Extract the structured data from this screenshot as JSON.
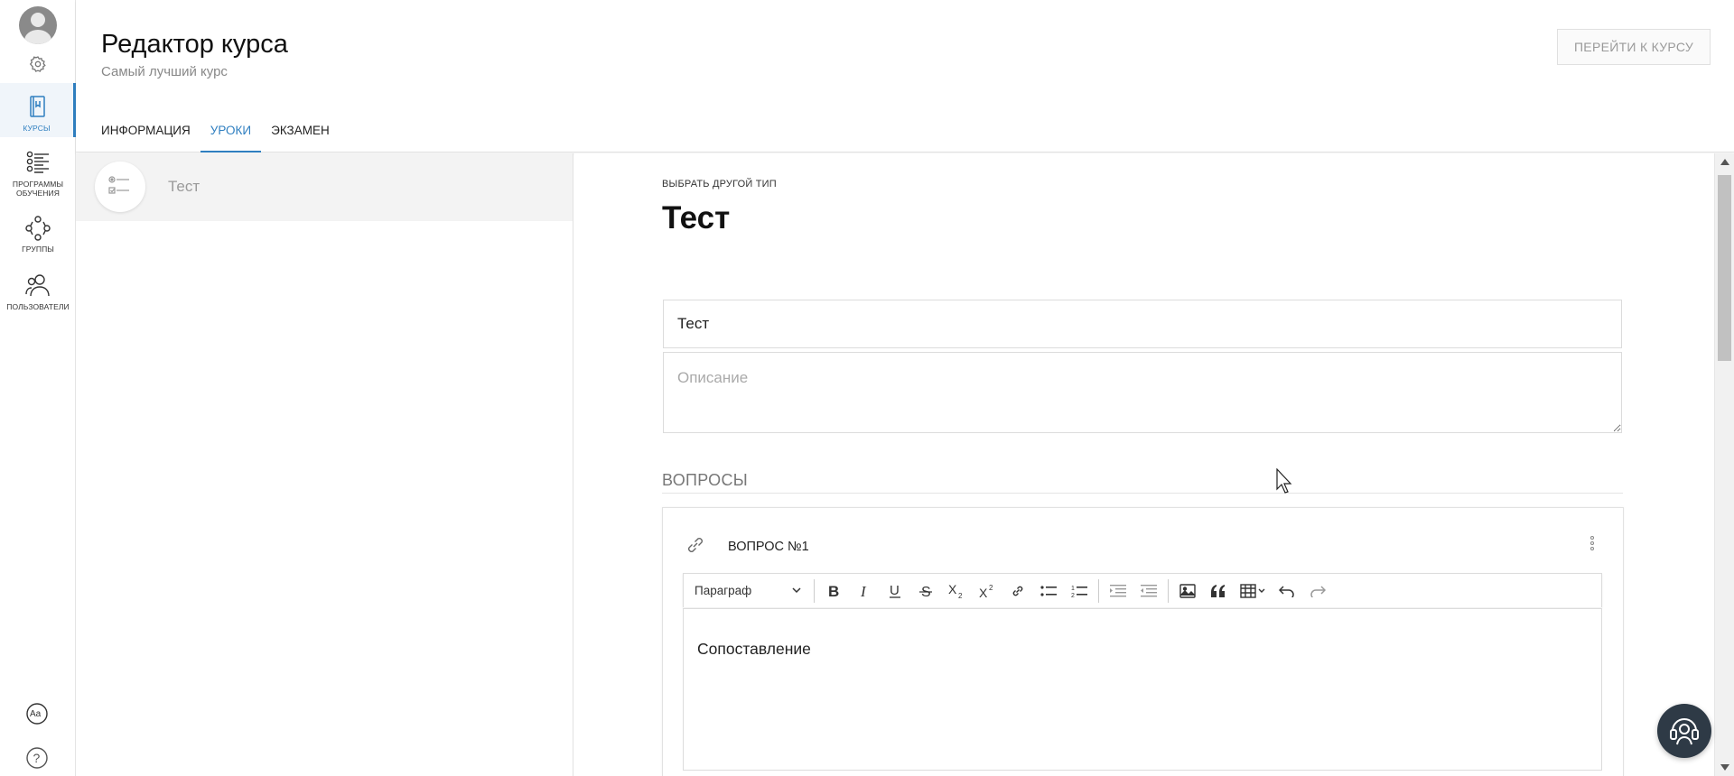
{
  "sidebar": {
    "items": [
      {
        "label": "КУРСЫ",
        "icon": "book-icon",
        "active": true
      },
      {
        "label": "ПРОГРАММЫ ОБУЧЕНИЯ",
        "icon": "checklist-icon",
        "active": false
      },
      {
        "label": "ГРУППЫ",
        "icon": "group-icon",
        "active": false
      },
      {
        "label": "ПОЛЬЗОВАТЕЛИ",
        "icon": "users-icon",
        "active": false
      }
    ]
  },
  "header": {
    "title": "Редактор курса",
    "subtitle": "Самый лучший курс",
    "goto_button": "ПЕРЕЙТИ К КУРСУ",
    "tabs": [
      {
        "label": "ИНФОРМАЦИЯ",
        "active": false
      },
      {
        "label": "УРОКИ",
        "active": true
      },
      {
        "label": "ЭКЗАМЕН",
        "active": false
      }
    ]
  },
  "lessons": [
    {
      "name": "Тест",
      "icon": "test-icon"
    }
  ],
  "editor": {
    "change_type": "ВЫБРАТЬ ДРУГОЙ ТИП",
    "title": "Тест",
    "title_input_value": "Тест",
    "description_placeholder": "Описание",
    "questions_heading": "ВОПРОСЫ",
    "question": {
      "label": "ВОПРОС №1",
      "toolbar_format": "Параграф",
      "content": "Сопоставление"
    }
  },
  "colors": {
    "accent": "#2f7fc0",
    "support_button": "#2e3a46"
  }
}
